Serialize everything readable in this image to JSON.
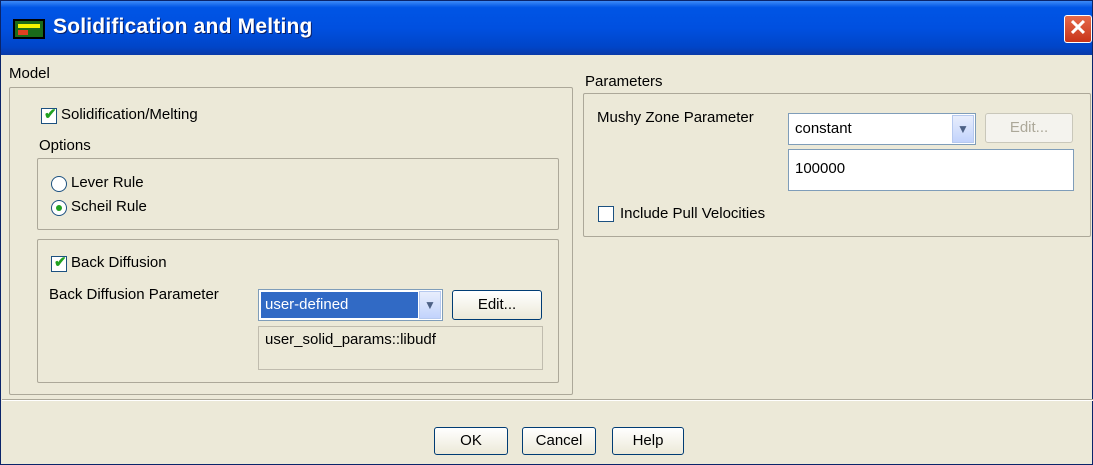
{
  "window": {
    "title": "Solidification and Melting"
  },
  "model": {
    "group_label": "Model",
    "solidification_label": "Solidification/Melting",
    "solidification_checked": true,
    "options_label": "Options",
    "options": [
      {
        "label": "Lever Rule",
        "selected": false
      },
      {
        "label": "Scheil Rule",
        "selected": true
      }
    ],
    "back_diffusion_label": "Back Diffusion",
    "back_diffusion_checked": true,
    "bd_param_label": "Back Diffusion Parameter",
    "bd_param_value": "user-defined",
    "bd_edit_label": "Edit...",
    "bd_udf_value": "user_solid_params::libudf"
  },
  "parameters": {
    "group_label": "Parameters",
    "mushy_label": "Mushy Zone Parameter",
    "mushy_method": "constant",
    "mushy_edit_label": "Edit...",
    "mushy_value": "100000",
    "pull_label": "Include Pull Velocities",
    "pull_checked": false
  },
  "footer": {
    "ok": "OK",
    "cancel": "Cancel",
    "help": "Help"
  },
  "colors": {
    "titlebar": "#0055e5",
    "dialog_bg": "#ece9d8",
    "check_mark": "#21a121",
    "selection": "#316ac5"
  }
}
